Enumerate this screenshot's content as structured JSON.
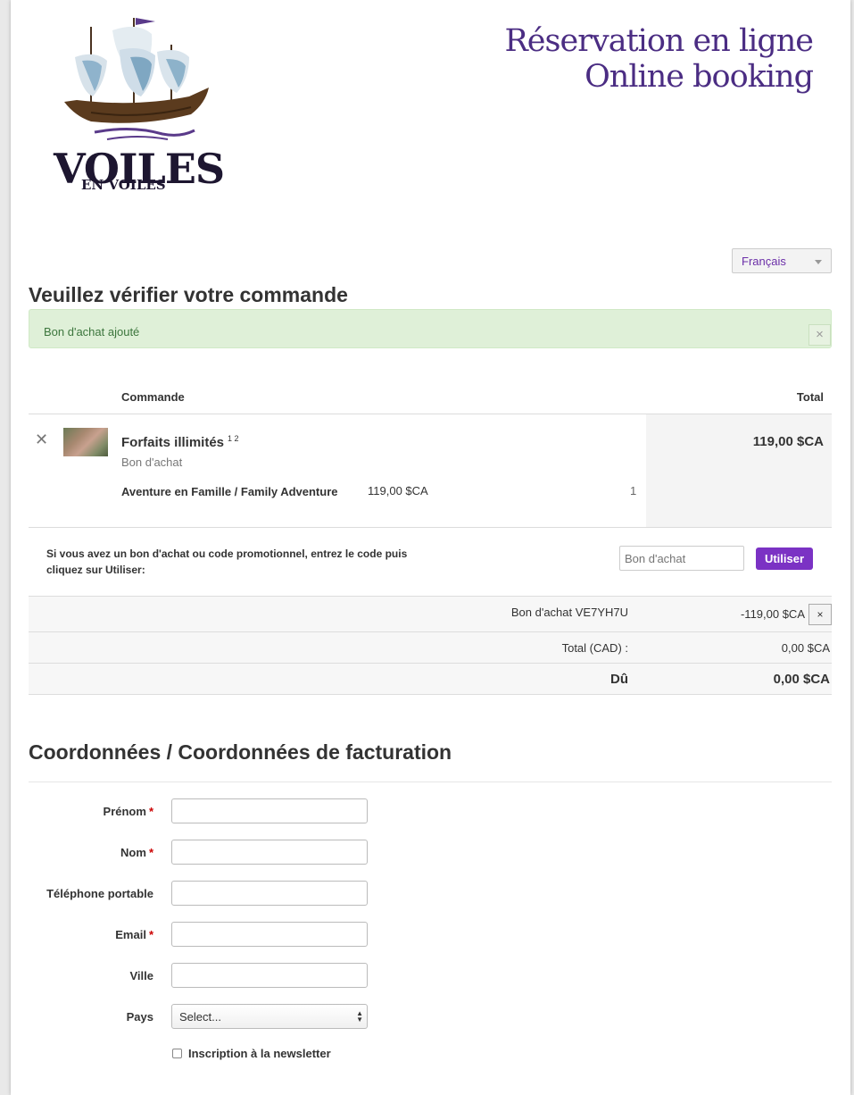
{
  "header": {
    "logo_word": "VOILES",
    "logo_sub": "EN VOILES",
    "title_line1": "Réservation en ligne",
    "title_line2": "Online booking"
  },
  "language": {
    "selected": "Français"
  },
  "review": {
    "heading": "Veuillez vérifier votre commande",
    "alert_text": "Bon d'achat ajouté",
    "alert_close": "×"
  },
  "order_table": {
    "col_order": "Commande",
    "col_total": "Total",
    "items": [
      {
        "remove": "✕",
        "title": "Forfaits illimités",
        "notes": "1 2",
        "subtitle": "Bon d'achat",
        "variant": "Aventure en Famille / Family Adventure",
        "price": "119,00 $CA",
        "qty": "1",
        "total": "119,00 $CA"
      }
    ]
  },
  "promo": {
    "text": "Si vous avez un bon d'achat ou code promotionnel, entrez le code puis cliquez sur Utiliser:",
    "placeholder": "Bon d'achat",
    "button": "Utiliser"
  },
  "summary": {
    "coupon_label": "Bon d'achat VE7YH7U",
    "coupon_value": "-119,00 $CA",
    "coupon_remove": "×",
    "total_label": "Total (CAD) :",
    "total_value": "0,00 $CA",
    "due_label": "Dû",
    "due_value": "0,00 $CA"
  },
  "billing": {
    "heading": "Coordonnées / Coordonnées de facturation",
    "first_name": "Prénom",
    "last_name": "Nom",
    "mobile": "Téléphone portable",
    "email": "Email",
    "city": "Ville",
    "country": "Pays",
    "country_selected": "Select...",
    "required_mark": "*",
    "newsletter": "Inscription à la newsletter"
  },
  "colors": {
    "brand_purple": "#4b2d83",
    "button_purple": "#7b32c4",
    "alert_bg": "#dff0d8",
    "alert_text": "#3c763d"
  }
}
